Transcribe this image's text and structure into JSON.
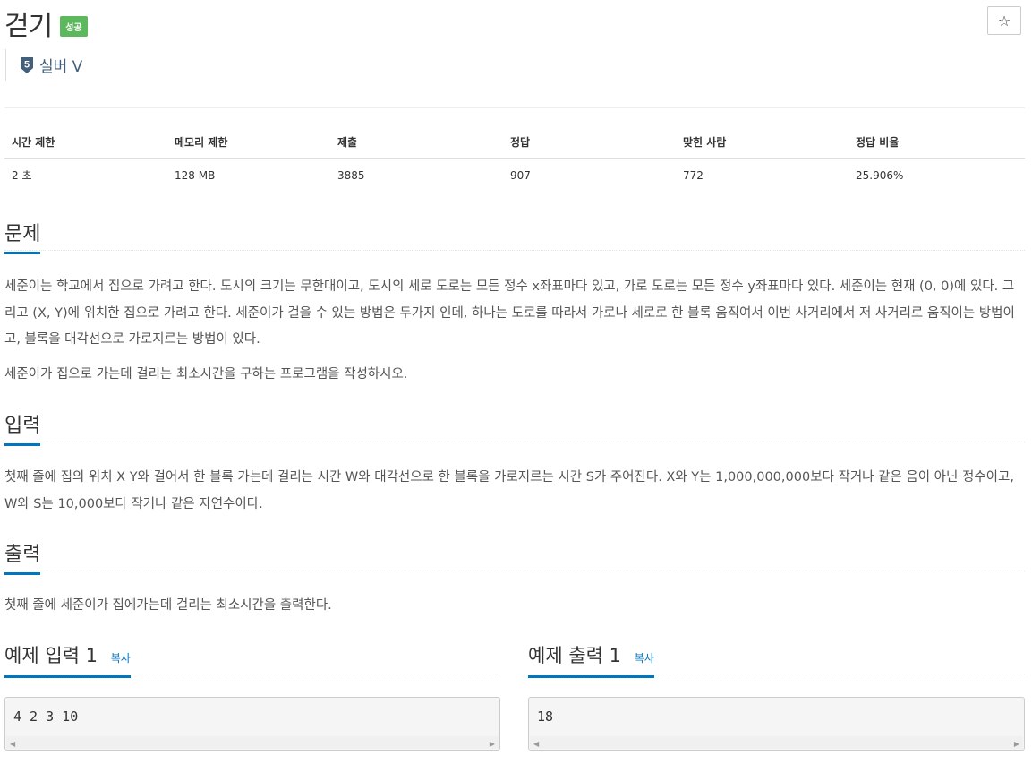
{
  "problem": {
    "title": "걷기",
    "status_badge": "성공",
    "tier_number": "5",
    "tier_label": "실버 V",
    "star_icon": "☆"
  },
  "info_table": {
    "headers": [
      "시간 제한",
      "메모리 제한",
      "제출",
      "정답",
      "맞힌 사람",
      "정답 비율"
    ],
    "values": [
      "2 초",
      "128 MB",
      "3885",
      "907",
      "772",
      "25.906%"
    ]
  },
  "sections": {
    "problem_title": "문제",
    "problem_body_1": "세준이는 학교에서 집으로 가려고 한다. 도시의 크기는 무한대이고, 도시의 세로 도로는 모든 정수 x좌표마다 있고, 가로 도로는 모든 정수 y좌표마다 있다. 세준이는 현재 (0, 0)에 있다. 그리고 (X, Y)에 위치한 집으로 가려고 한다. 세준이가 걸을 수 있는 방법은 두가지 인데, 하나는 도로를 따라서 가로나 세로로 한 블록 움직여서 이번 사거리에서 저 사거리로 움직이는 방법이고, 블록을 대각선으로 가로지르는 방법이 있다.",
    "problem_body_2": "세준이가 집으로 가는데 걸리는 최소시간을 구하는 프로그램을 작성하시오.",
    "input_title": "입력",
    "input_body": "첫째 줄에 집의 위치 X Y와 걸어서 한 블록 가는데 걸리는 시간 W와 대각선으로 한 블록을 가로지르는 시간 S가 주어진다. X와 Y는 1,000,000,000보다 작거나 같은 음이 아닌 정수이고, W와 S는 10,000보다 작거나 같은 자연수이다.",
    "output_title": "출력",
    "output_body": "첫째 줄에 세준이가 집에가는데 걸리는 최소시간을 출력한다."
  },
  "samples": {
    "input_title": "예제 입력",
    "input_num": "1",
    "output_title": "예제 출력",
    "output_num": "1",
    "copy_label": "복사",
    "input_code": "4 2 3 10",
    "output_code": "18"
  },
  "colors": {
    "accent": "#0076c0",
    "success": "#5cb85c",
    "tier": "#435f7a"
  }
}
